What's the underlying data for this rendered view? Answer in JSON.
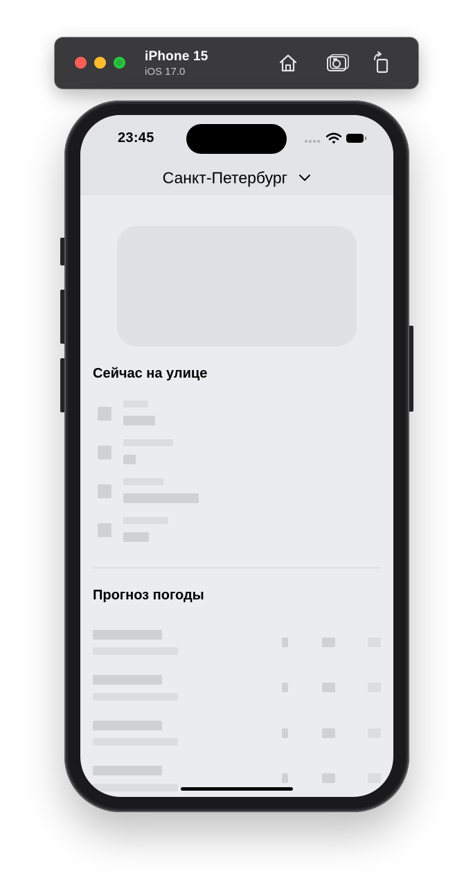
{
  "toolbar": {
    "device_name": "iPhone 15",
    "os_version": "iOS 17.0",
    "buttons": [
      "home-icon",
      "screenshot-icon",
      "rotate-icon"
    ]
  },
  "status_bar": {
    "time": "23:45"
  },
  "nav": {
    "city": "Санкт-Петербург"
  },
  "sections": {
    "now": "Сейчас на улице",
    "forecast": "Прогноз погоды"
  },
  "colors": {
    "screen_background": "#ebecef",
    "header_background": "#e3e4e7",
    "skeleton": "#cfd1d4",
    "skeleton_light": "#dcdde1"
  }
}
